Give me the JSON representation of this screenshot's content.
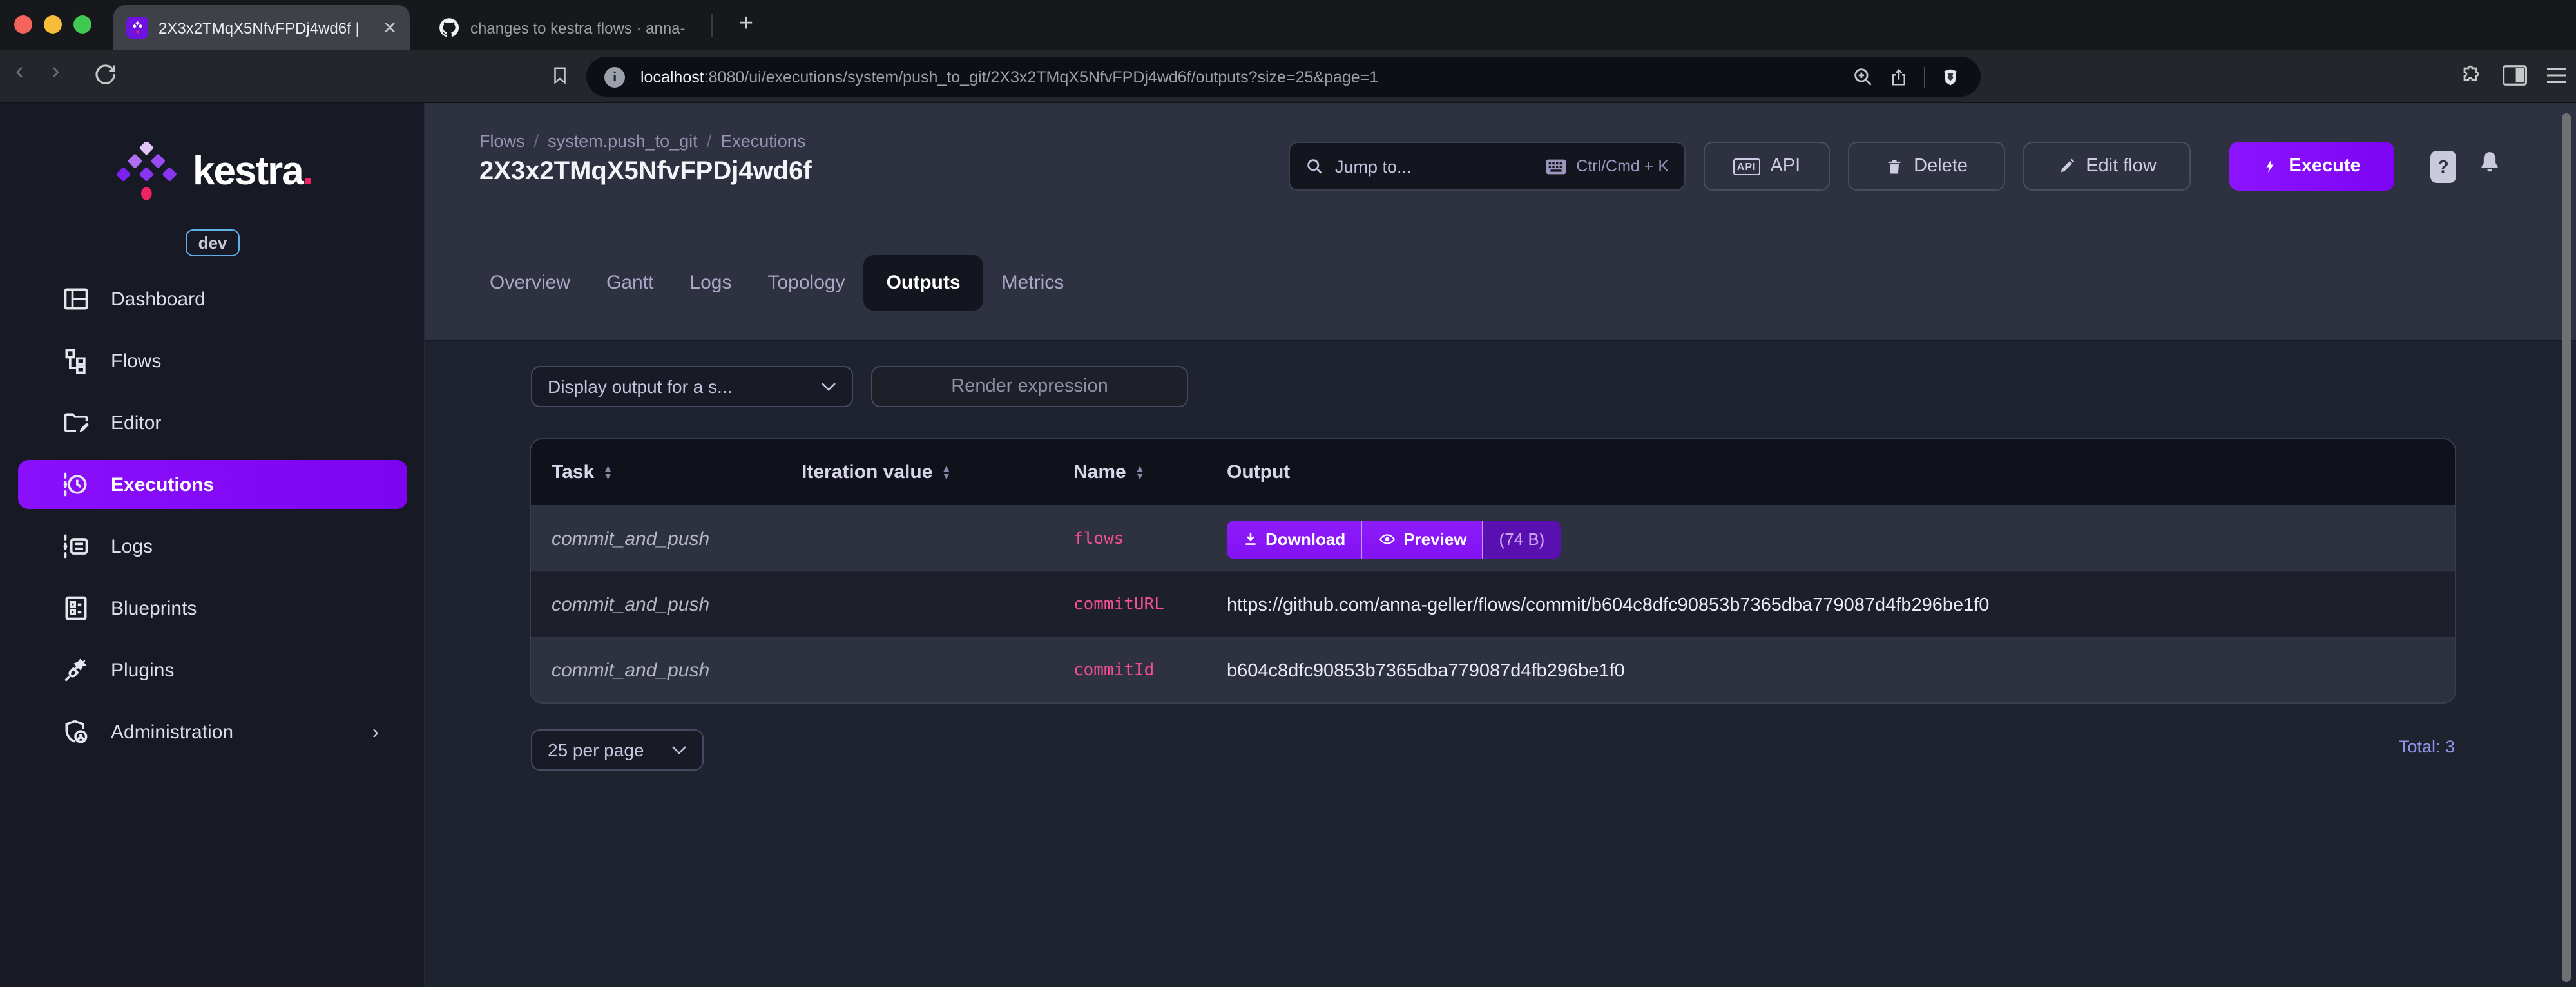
{
  "colors": {
    "accent_purple": "#8405F7",
    "pink": "#F2508E",
    "brand_pink_dot": "#ED2362",
    "header_bg": "#2E3140",
    "content_bg": "#1F222F",
    "sidebar_bg": "#171A24"
  },
  "browser": {
    "tabs": [
      {
        "title": "2X3x2TMqX5NfvFPDj4wd6f |"
      },
      {
        "title": "changes to kestra flows · anna-ge"
      }
    ],
    "url": {
      "host": "localhost",
      "rest": ":8080/ui/executions/system/push_to_git/2X3x2TMqX5NfvFPDj4wd6f/outputs?size=25&page=1"
    }
  },
  "sidebar": {
    "brand": "kestra",
    "brand_dot": ".",
    "env_badge": "dev",
    "items": [
      {
        "label": "Dashboard"
      },
      {
        "label": "Flows"
      },
      {
        "label": "Editor"
      },
      {
        "label": "Executions"
      },
      {
        "label": "Logs"
      },
      {
        "label": "Blueprints"
      },
      {
        "label": "Plugins"
      },
      {
        "label": "Administration"
      }
    ]
  },
  "header": {
    "breadcrumb": [
      "Flows",
      "system.push_to_git",
      "Executions"
    ],
    "title": "2X3x2TMqX5NfvFPDj4wd6f",
    "jump_to": {
      "placeholder": "Jump to...",
      "shortcut": "Ctrl/Cmd + K"
    },
    "buttons": {
      "api_cap": "API",
      "api": "API",
      "delete": "Delete",
      "edit_flow": "Edit flow",
      "execute": "Execute",
      "help": "?"
    }
  },
  "tabs": [
    {
      "label": "Overview"
    },
    {
      "label": "Gantt"
    },
    {
      "label": "Logs"
    },
    {
      "label": "Topology"
    },
    {
      "label": "Outputs"
    },
    {
      "label": "Metrics"
    }
  ],
  "outputs": {
    "display_select": "Display output for a s...",
    "render_button": "Render expression",
    "table": {
      "columns": [
        "Task",
        "Iteration value",
        "Name",
        "Output"
      ],
      "rows": [
        {
          "task": "commit_and_push",
          "iteration": "",
          "name": "flows",
          "download": "Download",
          "preview": "Preview",
          "size": "(74 B)"
        },
        {
          "task": "commit_and_push",
          "iteration": "",
          "name": "commitURL",
          "value": "https://github.com/anna-geller/flows/commit/b604c8dfc90853b7365dba779087d4fb296be1f0"
        },
        {
          "task": "commit_and_push",
          "iteration": "",
          "name": "commitId",
          "value": "b604c8dfc90853b7365dba779087d4fb296be1f0"
        }
      ]
    },
    "pagination": {
      "per_page": "25 per page",
      "total": "Total: 3"
    }
  }
}
